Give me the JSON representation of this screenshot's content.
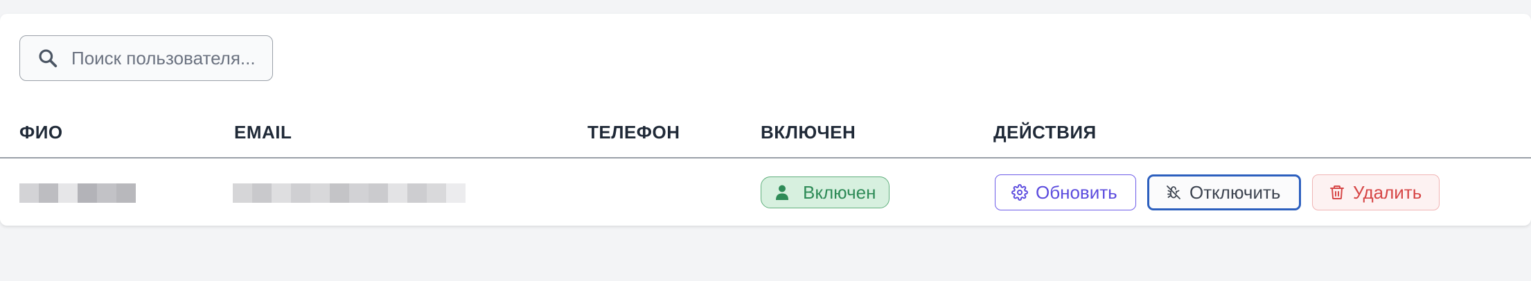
{
  "search": {
    "placeholder": "Поиск пользователя...",
    "value": ""
  },
  "table": {
    "columns": [
      "ФИО",
      "EMAIL",
      "ТЕЛЕФОН",
      "ВКЛЮЧЕН",
      "ДЕЙСТВИЯ"
    ],
    "rows": [
      {
        "full_name": "[redacted]",
        "email": "[redacted]",
        "phone": "",
        "status_label": "Включен",
        "actions": {
          "update_label": "Обновить",
          "disable_label": "Отключить",
          "delete_label": "Удалить"
        }
      }
    ]
  },
  "icons": {
    "search": "search-icon",
    "status": "user-icon",
    "update": "gear-icon",
    "disable": "bug-off-icon",
    "delete": "trash-icon"
  },
  "colors": {
    "page_background": "#f3f4f6",
    "card_background": "#ffffff",
    "status_green": "#2e8b57",
    "status_green_bg": "#d7f0df",
    "update_purple": "#5b4bde",
    "disable_blue": "#2c5fbe",
    "delete_red": "#d64545"
  }
}
